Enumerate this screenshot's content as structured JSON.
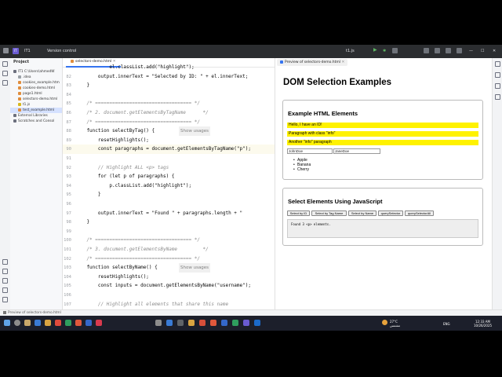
{
  "titlebar": {
    "project_badge": "IT",
    "project_name": "IT1",
    "vcs_label": "Version control",
    "run_config": "t1.js",
    "preview_tab": "Preview of selectors-demo.html"
  },
  "project_panel": {
    "title": "Project",
    "items": [
      {
        "label": "IT1  C:\\Users\\ahmedW",
        "indent": 0,
        "color": "#6c707e"
      },
      {
        "label": ".idea",
        "indent": 1,
        "color": "#9aa0a6"
      },
      {
        "label": "cookies_example.htm",
        "indent": 1,
        "color": "#e08d3c"
      },
      {
        "label": "cookies-demo.html",
        "indent": 1,
        "color": "#e08d3c"
      },
      {
        "label": "page1.html",
        "indent": 1,
        "color": "#e08d3c"
      },
      {
        "label": "selectors-demo.html",
        "indent": 1,
        "color": "#e08d3c"
      },
      {
        "label": "t1.js",
        "indent": 1,
        "color": "#d7b81a"
      },
      {
        "label": "test_example.html",
        "indent": 1,
        "color": "#e08d3c",
        "selected": true
      },
      {
        "label": "External Libraries",
        "indent": 0,
        "color": "#6c707e"
      },
      {
        "label": "Scratches and Consol",
        "indent": 0,
        "color": "#6c707e"
      }
    ]
  },
  "editor": {
    "tab_label": "selectors-demo.html",
    "lines": [
      {
        "n": "",
        "html": "            el.classList.add(\"highlight\");",
        "cls": ""
      },
      {
        "n": "82",
        "html": "        output.innerText = \"Selected by ID: \" + el.innerText;",
        "cls": ""
      },
      {
        "n": "83",
        "html": "    }",
        "cls": ""
      },
      {
        "n": "84",
        "html": "",
        "cls": ""
      },
      {
        "n": "85",
        "html": "    /* ================================== */",
        "cls": "cm"
      },
      {
        "n": "86",
        "html": "    /* 2. document.getElementsByTagName      */",
        "cls": "cm"
      },
      {
        "n": "87",
        "html": "    /* ================================== */",
        "cls": "cm"
      },
      {
        "n": "88",
        "html": "    function selectByTag() {",
        "cls": "",
        "hint": "Show usages"
      },
      {
        "n": "89",
        "html": "        resetHighlights();",
        "cls": ""
      },
      {
        "n": "90",
        "html": "        const paragraphs = document.getElementsByTagName(\"p\");",
        "cls": "",
        "active": true
      },
      {
        "n": "91",
        "html": "",
        "cls": ""
      },
      {
        "n": "92",
        "html": "        // Highlight ALL <p> tags",
        "cls": "cm"
      },
      {
        "n": "93",
        "html": "        for (let p of paragraphs) {",
        "cls": ""
      },
      {
        "n": "94",
        "html": "            p.classList.add(\"highlight\");",
        "cls": ""
      },
      {
        "n": "95",
        "html": "        }",
        "cls": ""
      },
      {
        "n": "96",
        "html": "",
        "cls": ""
      },
      {
        "n": "97",
        "html": "        output.innerText = \"Found \" + paragraphs.length + \"",
        "cls": ""
      },
      {
        "n": "98",
        "html": "    }",
        "cls": ""
      },
      {
        "n": "99",
        "html": "",
        "cls": ""
      },
      {
        "n": "100",
        "html": "    /* ================================== */",
        "cls": "cm"
      },
      {
        "n": "101",
        "html": "    /* 3. document.getElementsByName         */",
        "cls": "cm"
      },
      {
        "n": "102",
        "html": "    /* ================================== */",
        "cls": "cm"
      },
      {
        "n": "103",
        "html": "    function selectByName() {",
        "cls": "",
        "hint": "Show usages"
      },
      {
        "n": "104",
        "html": "        resetHighlights();",
        "cls": ""
      },
      {
        "n": "105",
        "html": "        const inputs = document.getElementsByName(\"username\");",
        "cls": ""
      },
      {
        "n": "106",
        "html": "",
        "cls": ""
      },
      {
        "n": "107",
        "html": "        // Highlight all elements that share this name",
        "cls": "cm"
      },
      {
        "n": "108",
        "html": "        for (let input of inputs) {",
        "cls": ""
      }
    ]
  },
  "preview": {
    "page_title": "DOM Selection Examples",
    "example_heading": "Example HTML Elements",
    "highlighted_paragraphs": [
      "Hello, I have an ID!",
      "Paragraph with class \"info\"",
      "Another \"info\" paragraph"
    ],
    "input1_value": "JohnDoe",
    "input2_value": "JaneDoe",
    "list_items": [
      "Apple",
      "Banana",
      "Cherry"
    ],
    "select_heading": "Select Elements Using JavaScript",
    "buttons": [
      "Select by ID",
      "Select by Tag Name",
      "Select by Name",
      "querySelector",
      "querySelectorAll"
    ],
    "output_text": "Found 3 <p> elements."
  },
  "statusbar": {
    "text": "Preview of selectors-demo.html"
  },
  "taskbar": {
    "weather": "27°C",
    "weather_sub": "مشمس",
    "lang": "ENG",
    "time": "12:33 AM",
    "date": "10/26/2025"
  }
}
